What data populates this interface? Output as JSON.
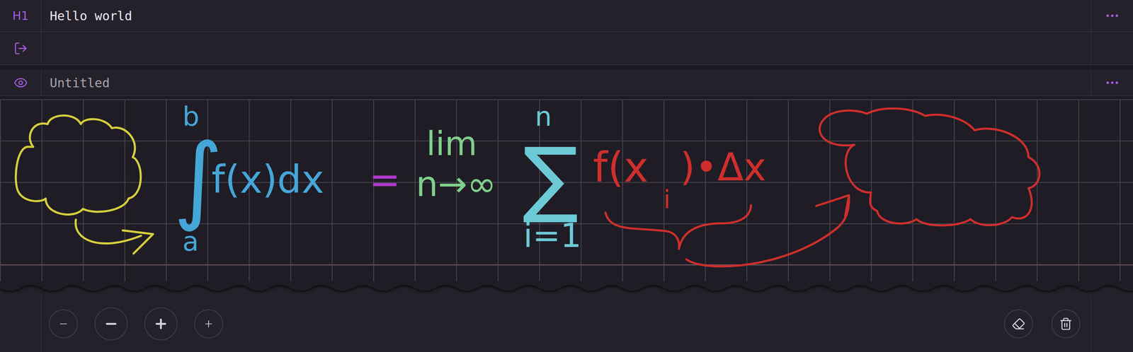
{
  "rows": [
    {
      "kind": "heading",
      "marker": "H1",
      "text": "Hello world",
      "menu": true
    },
    {
      "kind": "export",
      "text": "",
      "menu": false
    },
    {
      "kind": "title",
      "placeholder": "Untitled",
      "text": "",
      "menu": true
    }
  ],
  "canvas": {
    "ink": [
      {
        "text": "b",
        "color": "#45a6d8"
      },
      {
        "text": "∫",
        "color": "#45a6d8"
      },
      {
        "text": "a",
        "color": "#45a6d8"
      },
      {
        "text": "f(x)dx",
        "color": "#45a6d8"
      },
      {
        "text": "=",
        "color": "#b03ad0"
      },
      {
        "text": "lim",
        "color": "#7fd08a"
      },
      {
        "text": "n→∞",
        "color": "#7fd08a"
      },
      {
        "text": "∑",
        "color": "#6cc9d6"
      },
      {
        "text": "n",
        "color": "#6cc9d6"
      },
      {
        "text": "i=1",
        "color": "#6cc9d6"
      },
      {
        "text": "f(x",
        "color": "#cf2f2c"
      },
      {
        "text": "i",
        "color": "#cf2f2c"
      },
      {
        "text": ")•Δx",
        "color": "#cf2f2c"
      }
    ],
    "strokes": [
      {
        "kind": "cloud",
        "color": "#d6cf3e"
      },
      {
        "kind": "arrow",
        "color": "#d6cf3e"
      },
      {
        "kind": "brace",
        "color": "#cf2f2c"
      },
      {
        "kind": "arrow",
        "color": "#cf2f2c"
      },
      {
        "kind": "cloud",
        "color": "#cf2f2c"
      }
    ]
  },
  "toolbar": {
    "buttons": [
      {
        "kind": "minus",
        "size": "small"
      },
      {
        "kind": "minus",
        "size": "large"
      },
      {
        "kind": "plus",
        "size": "large"
      },
      {
        "kind": "plus",
        "size": "small"
      }
    ],
    "tools": [
      {
        "kind": "eraser"
      },
      {
        "kind": "delete"
      }
    ]
  }
}
